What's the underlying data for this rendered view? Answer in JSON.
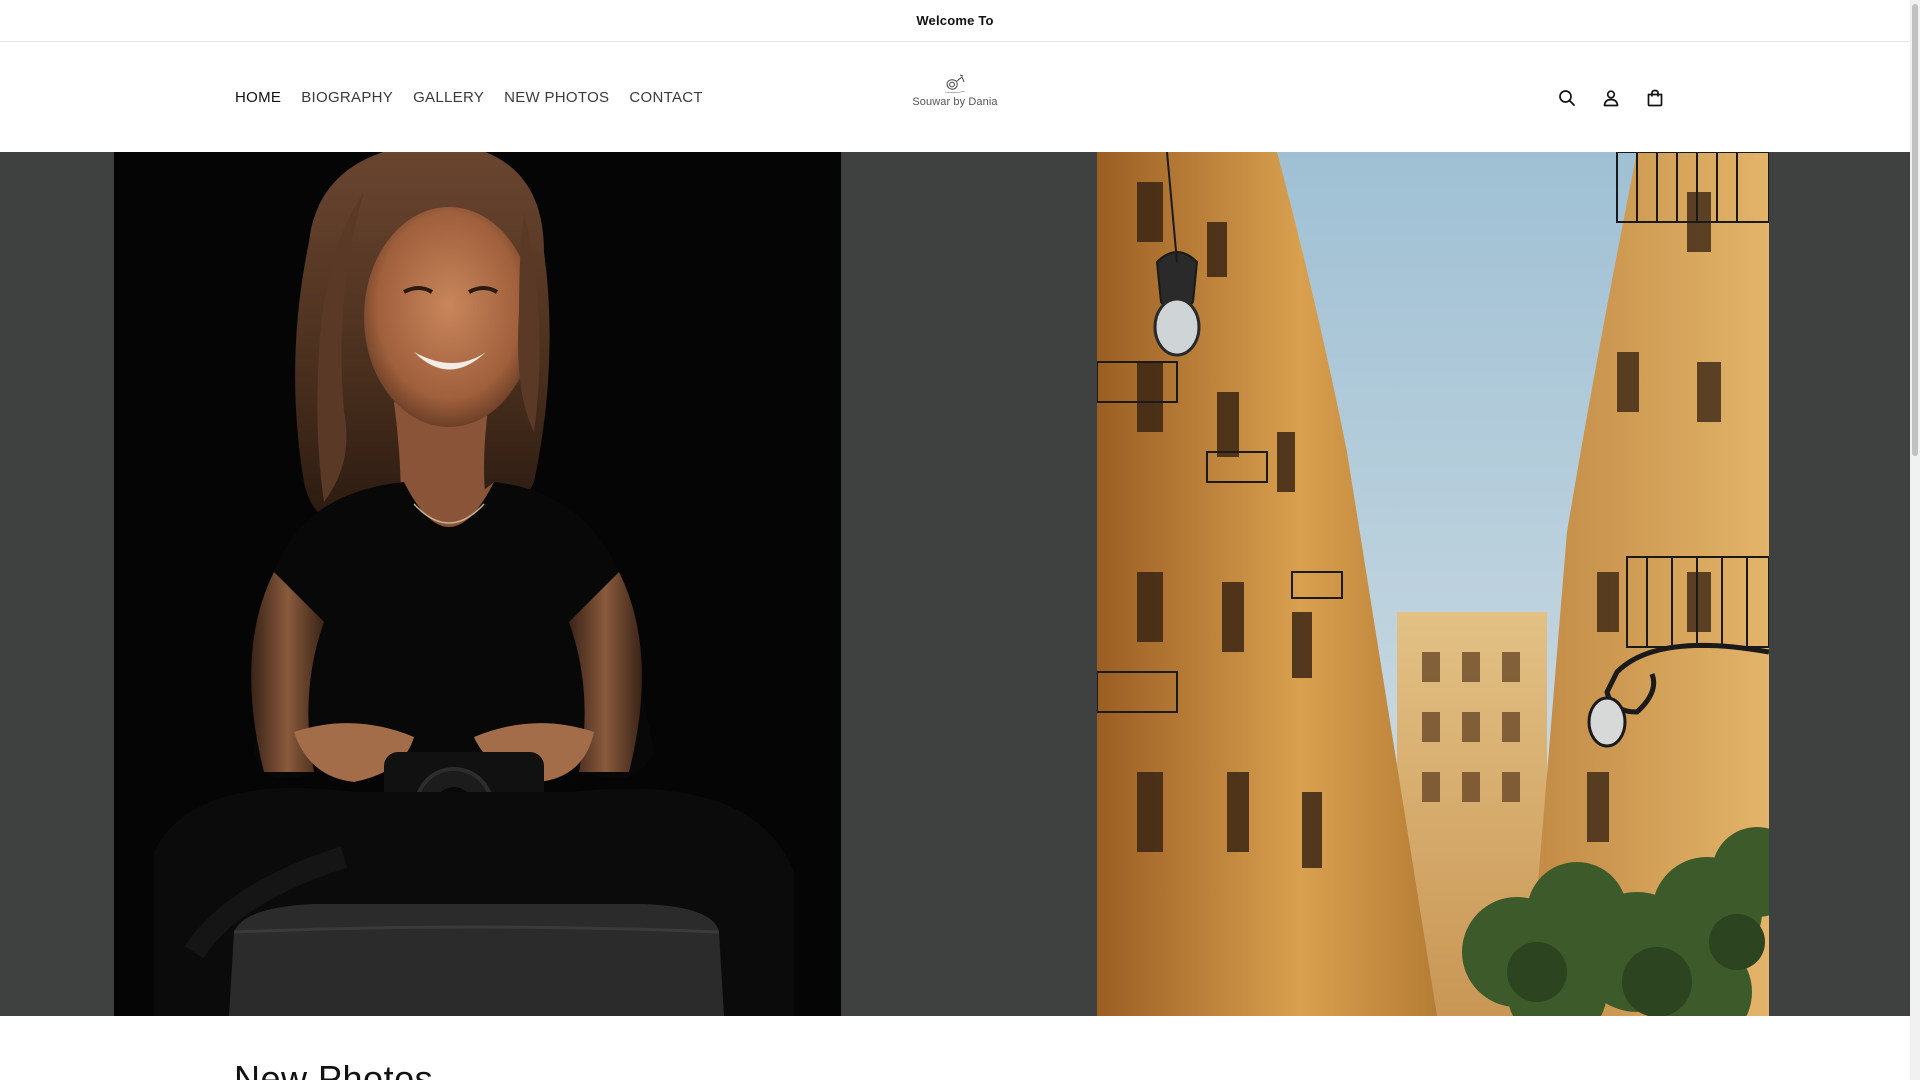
{
  "announcement": {
    "text": "Welcome To"
  },
  "nav": {
    "items": [
      {
        "label": "HOME"
      },
      {
        "label": "BIOGRAPHY"
      },
      {
        "label": "GALLERY"
      },
      {
        "label": "NEW PHOTOS"
      },
      {
        "label": "CONTACT"
      }
    ]
  },
  "logo": {
    "text": "Souwar by Dania",
    "icon": "camera-logo-icon"
  },
  "header_icons": [
    {
      "icon": "search-icon"
    },
    {
      "icon": "account-icon"
    },
    {
      "icon": "cart-icon"
    }
  ],
  "hero": {
    "left_image": "portrait-woman-with-camera",
    "right_image": "street-buildings-balconies",
    "colors": {
      "background": "#3f4040",
      "portrait_bg": "#050505",
      "sky": "#a9c6d6",
      "building": "#d59a45"
    }
  },
  "section": {
    "title": "New Photos"
  }
}
